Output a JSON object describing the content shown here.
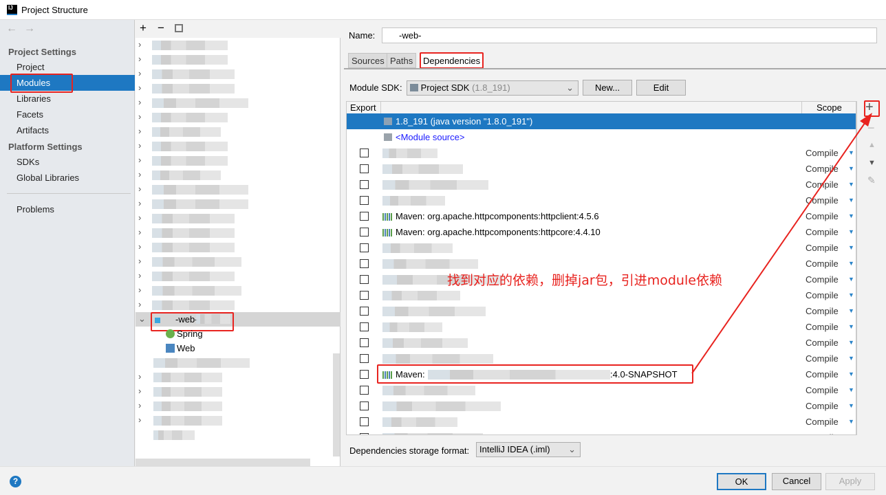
{
  "window": {
    "title": "Project Structure",
    "logo": "IJ"
  },
  "sidebar": {
    "back_icon": "arrow-left",
    "forward_icon": "arrow-right",
    "project_settings": "Project Settings",
    "items_project": [
      {
        "label": "Project"
      },
      {
        "label": "Modules",
        "selected": true
      },
      {
        "label": "Libraries"
      },
      {
        "label": "Facets"
      },
      {
        "label": "Artifacts"
      }
    ],
    "platform_settings": "Platform Settings",
    "items_platform": [
      {
        "label": "SDKs"
      },
      {
        "label": "Global Libraries"
      }
    ],
    "problems": "Problems"
  },
  "tree": {
    "toolbar": {
      "add": "+",
      "remove": "−"
    },
    "selected_module": "-web-",
    "children": [
      {
        "label": "Spring",
        "icon": "spring-leaf"
      },
      {
        "label": "Web",
        "icon": "web-facet"
      }
    ]
  },
  "module": {
    "name_label": "Name:",
    "name_value": "-web-",
    "tabs": [
      {
        "label": "Sources"
      },
      {
        "label": "Paths"
      },
      {
        "label": "Dependencies",
        "active": true
      }
    ],
    "sdk_label": "Module SDK:",
    "sdk_value": "Project SDK",
    "sdk_version": "(1.8_191)",
    "new_button": "New...",
    "edit_button": "Edit",
    "table": {
      "col_export": "Export",
      "col_scope": "Scope",
      "sdk_row": "1.8_191 (java version \"1.8.0_191\")",
      "module_source": "<Module source>",
      "rows": [
        {
          "name": "",
          "scope": "Compile"
        },
        {
          "name": "",
          "scope": "Compile"
        },
        {
          "name": "",
          "scope": "Compile"
        },
        {
          "name": "",
          "scope": "Compile"
        },
        {
          "name": "Maven: org.apache.httpcomponents:httpclient:4.5.6",
          "scope": "Compile"
        },
        {
          "name": "Maven: org.apache.httpcomponents:httpcore:4.4.10",
          "scope": "Compile"
        },
        {
          "name": "",
          "scope": "Compile"
        },
        {
          "name": "",
          "scope": "Compile"
        },
        {
          "name": "",
          "scope": "Compile"
        },
        {
          "name": "",
          "scope": "Compile"
        },
        {
          "name": "",
          "scope": "Compile"
        },
        {
          "name": "",
          "scope": "Compile"
        },
        {
          "name": "",
          "scope": "Compile"
        },
        {
          "name": "",
          "scope": "Compile"
        },
        {
          "name": "Maven: ",
          "suffix": ":4.0-SNAPSHOT",
          "scope": "Compile",
          "highlighted": true
        },
        {
          "name": "",
          "scope": "Compile"
        },
        {
          "name": "",
          "scope": "Compile"
        },
        {
          "name": "",
          "scope": "Compile"
        },
        {
          "name": "",
          "scope": "Compile"
        }
      ]
    },
    "side_toolbar": {
      "add": "+",
      "remove": "−",
      "up": "▲",
      "down": "▼",
      "edit": "✎"
    },
    "storage_label": "Dependencies storage format:",
    "storage_value": "IntelliJ IDEA (.iml)"
  },
  "annotation": {
    "text": "找到对应的依赖，删掉jar包，引进module依赖",
    "color": "#e8231f"
  },
  "footer": {
    "help": "?",
    "ok": "OK",
    "cancel": "Cancel",
    "apply": "Apply"
  },
  "colors": {
    "selection": "#1e78c2",
    "annotation": "#e8231f"
  }
}
